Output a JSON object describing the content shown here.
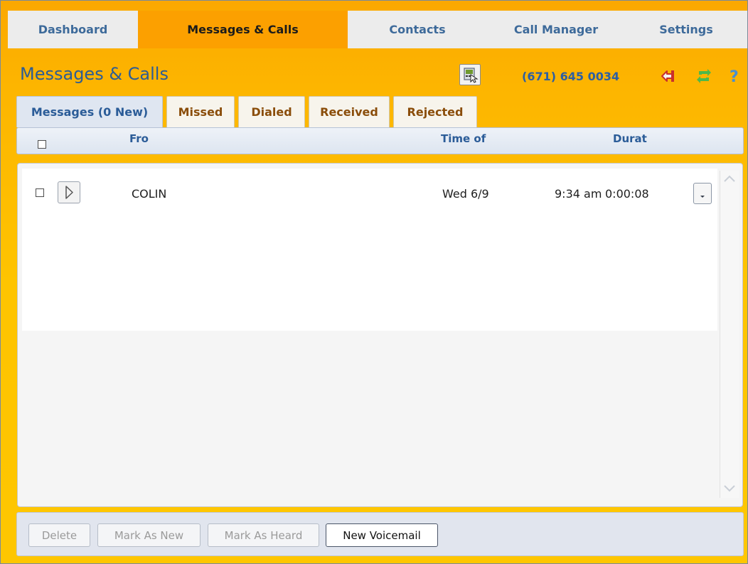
{
  "nav": {
    "tabs": [
      {
        "label": "Dashboard"
      },
      {
        "label": "Messages & Calls"
      },
      {
        "label": "Contacts"
      },
      {
        "label": "Call Manager"
      },
      {
        "label": "Settings"
      }
    ],
    "active_index": 1
  },
  "header": {
    "title": "Messages & Calls",
    "phone_number": "(671) 645 0034",
    "icons": [
      "kiosk-icon",
      "logout-icon",
      "refresh-icon",
      "help-icon"
    ]
  },
  "subtabs": {
    "items": [
      {
        "label": "Messages (0 New)"
      },
      {
        "label": "Missed"
      },
      {
        "label": "Dialed"
      },
      {
        "label": "Received"
      },
      {
        "label": "Rejected"
      }
    ],
    "active_index": 0
  },
  "columns": {
    "from": "Fro",
    "time": "Time of",
    "duration": "Durat"
  },
  "rows": [
    {
      "from": "COLIN",
      "date": "Wed 6/9",
      "time": "9:34 am",
      "duration": "0:00:08"
    }
  ],
  "footer": {
    "delete_label": "Delete",
    "mark_new_label": "Mark As New",
    "mark_heard_label": "Mark As Heard",
    "new_voicemail_label": "New Voicemail"
  },
  "colors": {
    "accent_orange": "#fca000",
    "link_blue": "#2b5c98"
  }
}
